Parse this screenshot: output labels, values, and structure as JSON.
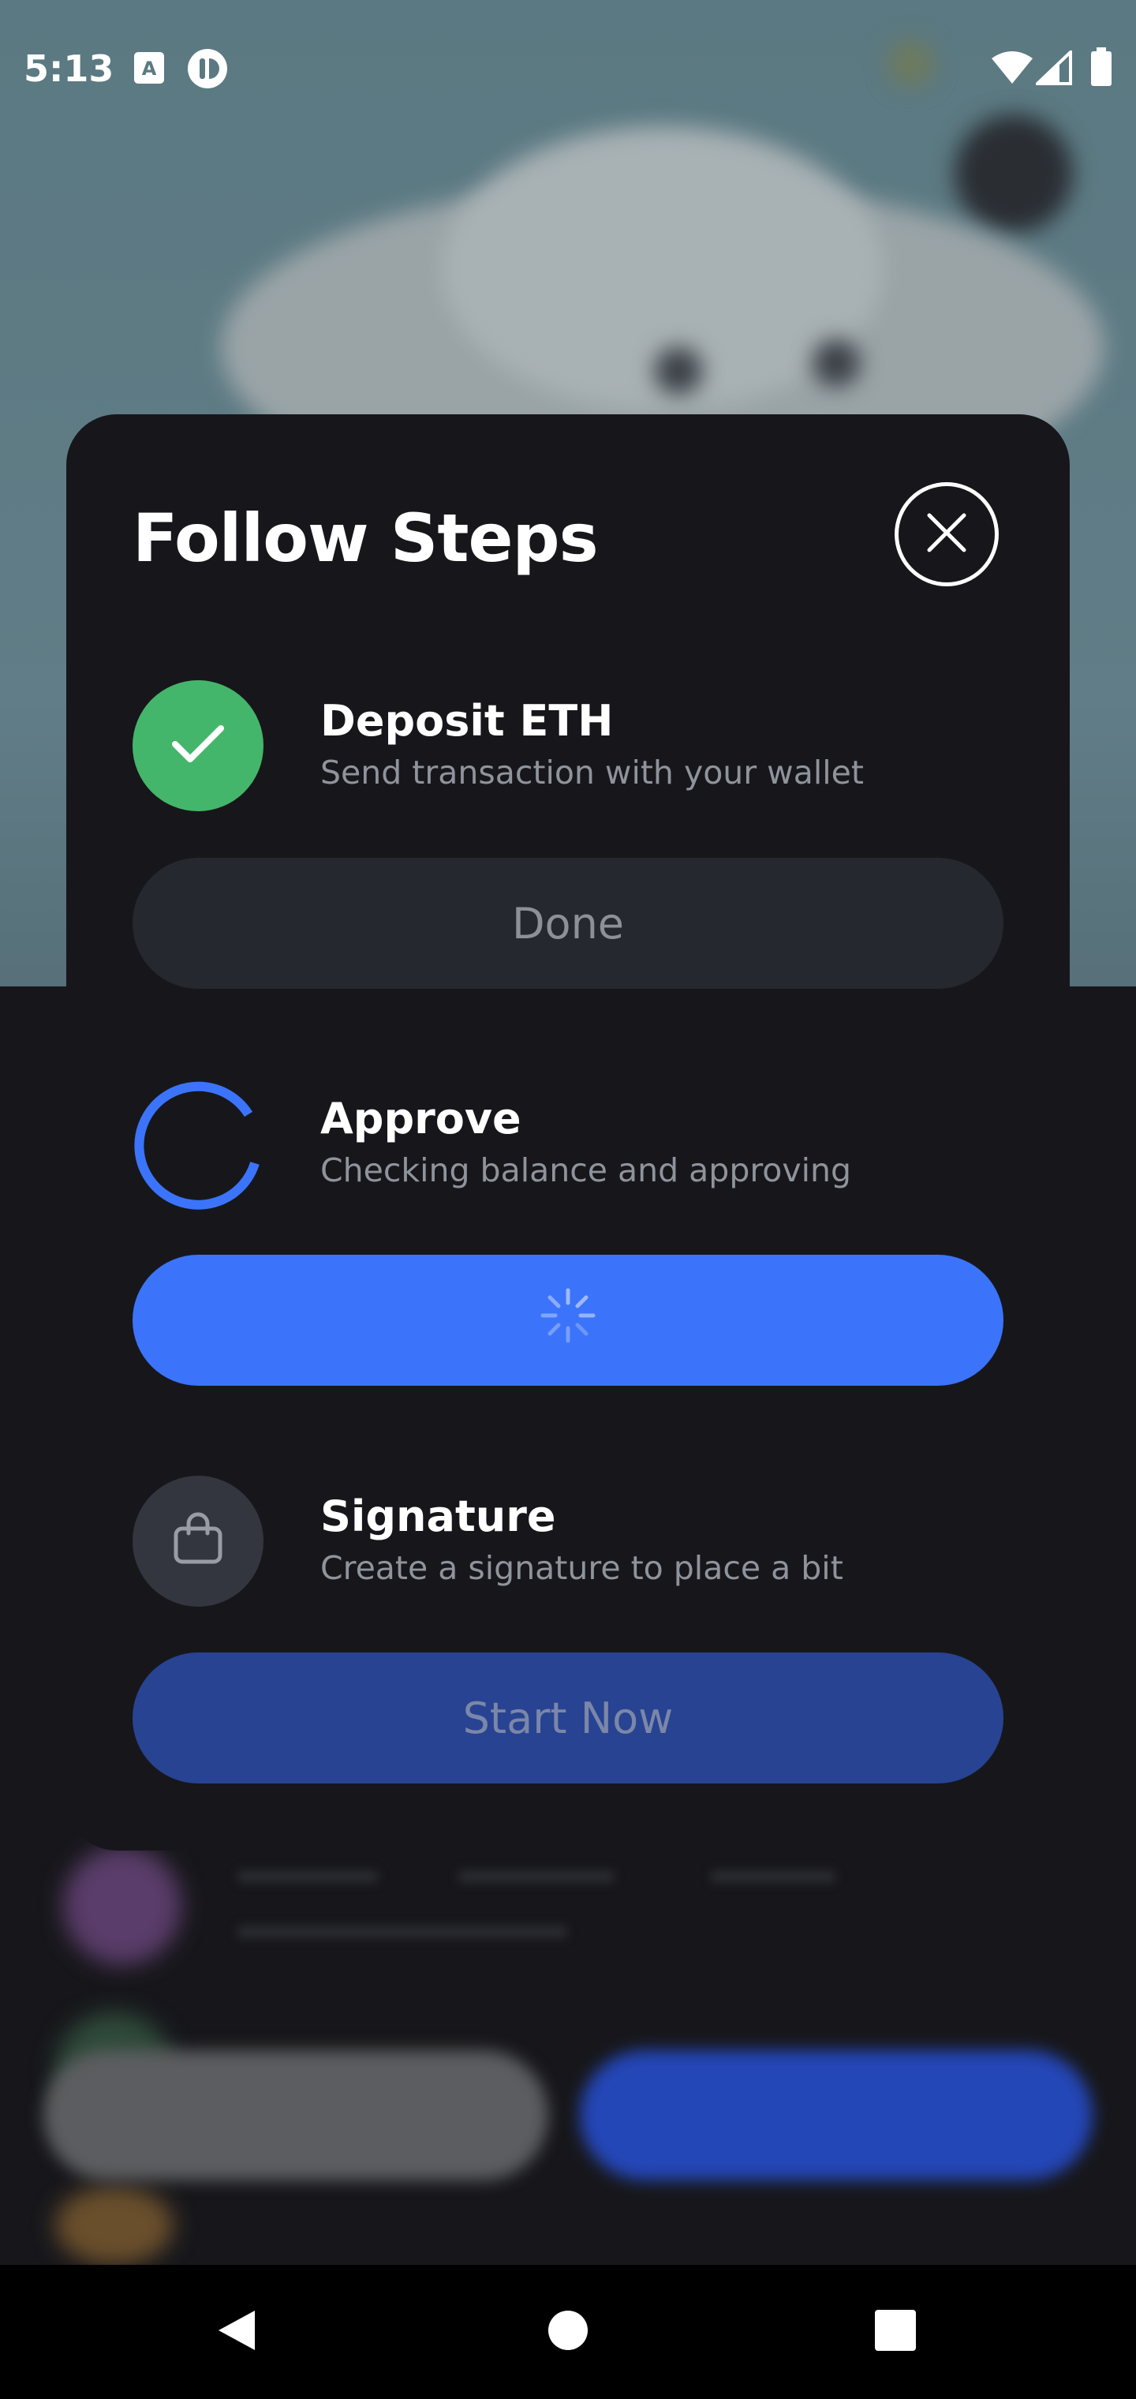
{
  "status_bar": {
    "time": "5:13"
  },
  "modal": {
    "title": "Follow Steps",
    "steps": [
      {
        "title": "Deposit ETH",
        "description": "Send transaction with your wallet",
        "state": "completed",
        "icon": "checkmark-icon",
        "button_label": "Done"
      },
      {
        "title": "Approve",
        "description": "Checking balance and approving",
        "state": "in-progress",
        "icon": "loading-ring-icon",
        "button_label": ""
      },
      {
        "title": "Signature",
        "description": "Create a signature to place a bit",
        "state": "pending",
        "icon": "shopping-bag-icon",
        "button_label": "Start Now"
      }
    ]
  },
  "colors": {
    "accent_blue": "#3b74fa",
    "success_green": "#44b66b",
    "modal_background": "#17171b",
    "muted_button": "#262830",
    "start_button": "#284392"
  }
}
